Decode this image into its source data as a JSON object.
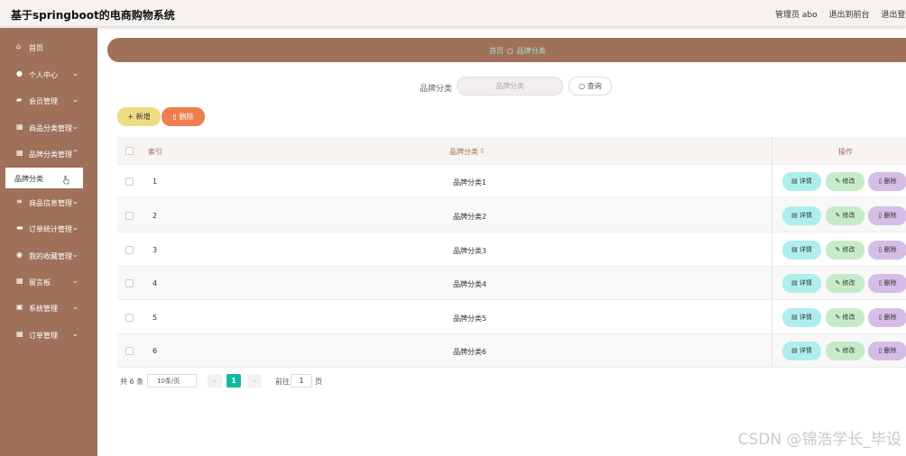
{
  "app": {
    "title": "基于springboot的电商购物系统"
  },
  "topbar": {
    "admin": "管理员 abo",
    "exit_front": "退出到前台",
    "exit_sys": "退出登录"
  },
  "sidebar": {
    "items": [
      {
        "label": "首页",
        "icon": "home-icon"
      },
      {
        "label": "个人中心",
        "icon": "user-icon"
      },
      {
        "label": "会员管理",
        "icon": "users-icon"
      },
      {
        "label": "商品分类管理",
        "icon": "grid-icon"
      },
      {
        "label": "品牌分类管理",
        "icon": "grid-icon"
      },
      {
        "label": "商品信息管理",
        "icon": "list-icon"
      },
      {
        "label": "订单统计管理",
        "icon": "chart-icon"
      },
      {
        "label": "我的收藏管理",
        "icon": "heart-icon"
      },
      {
        "label": "留言板",
        "icon": "grid-icon"
      },
      {
        "label": "系统管理",
        "icon": "gear-icon"
      },
      {
        "label": "订单管理",
        "icon": "grid-icon"
      }
    ],
    "active_sub": "品牌分类"
  },
  "breadcrumb": {
    "home": "首页",
    "current": "品牌分类"
  },
  "search": {
    "label": "品牌分类",
    "placeholder": "品牌分类",
    "button": "查询"
  },
  "toolbar": {
    "add": "新增",
    "delete": "删除"
  },
  "table": {
    "headers": {
      "index": "索引",
      "brand": "品牌分类",
      "ops": "操作"
    },
    "rows": [
      {
        "index": "1",
        "brand": "品牌分类1"
      },
      {
        "index": "2",
        "brand": "品牌分类2"
      },
      {
        "index": "3",
        "brand": "品牌分类3"
      },
      {
        "index": "4",
        "brand": "品牌分类4"
      },
      {
        "index": "5",
        "brand": "品牌分类5"
      },
      {
        "index": "6",
        "brand": "品牌分类6"
      }
    ],
    "ops": {
      "detail": "详情",
      "edit": "修改",
      "delete": "删除"
    }
  },
  "pager": {
    "total": "共 6 条",
    "size": "10条/页",
    "current": "1",
    "goto": "前往",
    "goto_value": "1",
    "page": "页"
  },
  "watermark": "CSDN @锦浩学长_毕设",
  "colors": {
    "sidebar": "#a0715a",
    "accent": "#14b8a0",
    "add": "#eddc82",
    "delete": "#f07d4d"
  }
}
